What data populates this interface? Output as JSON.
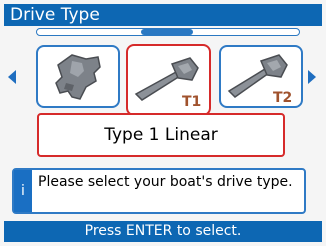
{
  "window": {
    "title": "Drive Type"
  },
  "selector": {
    "options": [
      {
        "icon": "sterndrive-icon",
        "badge": ""
      },
      {
        "icon": "linear-drive-icon",
        "badge": "T1"
      },
      {
        "icon": "linear-drive-icon",
        "badge": "T2"
      }
    ],
    "selected_label": "Type 1 Linear"
  },
  "info": {
    "icon_glyph": "i",
    "message": "Please select your boat's drive type."
  },
  "footer": {
    "hint": "Press ENTER to select."
  },
  "colors": {
    "accent": "#0d67b3",
    "selected_border": "#d62a2a",
    "option_border": "#2f7ac5"
  }
}
